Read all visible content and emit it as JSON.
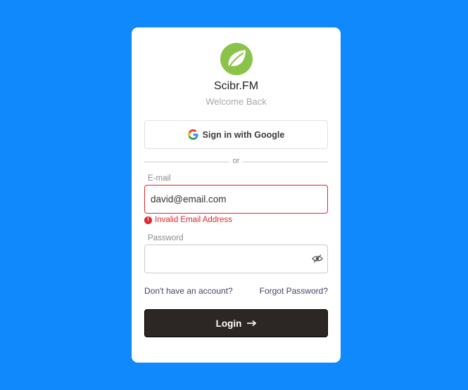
{
  "app": {
    "name": "Scibr.FM",
    "tagline": "Welcome Back"
  },
  "google": {
    "label": "Sign in with Google"
  },
  "divider": {
    "text": "or"
  },
  "email": {
    "label": "E-mail",
    "value": "david@email.com",
    "error": "Invalid Email Address"
  },
  "password": {
    "label": "Password",
    "value": ""
  },
  "links": {
    "signup": "Don't have an account?",
    "forgot": "Forgot Password?"
  },
  "login": {
    "label": "Login"
  },
  "colors": {
    "background": "#0f89fb",
    "error": "#e0262e",
    "button": "#2c2624",
    "logo": "#8bc34a"
  }
}
